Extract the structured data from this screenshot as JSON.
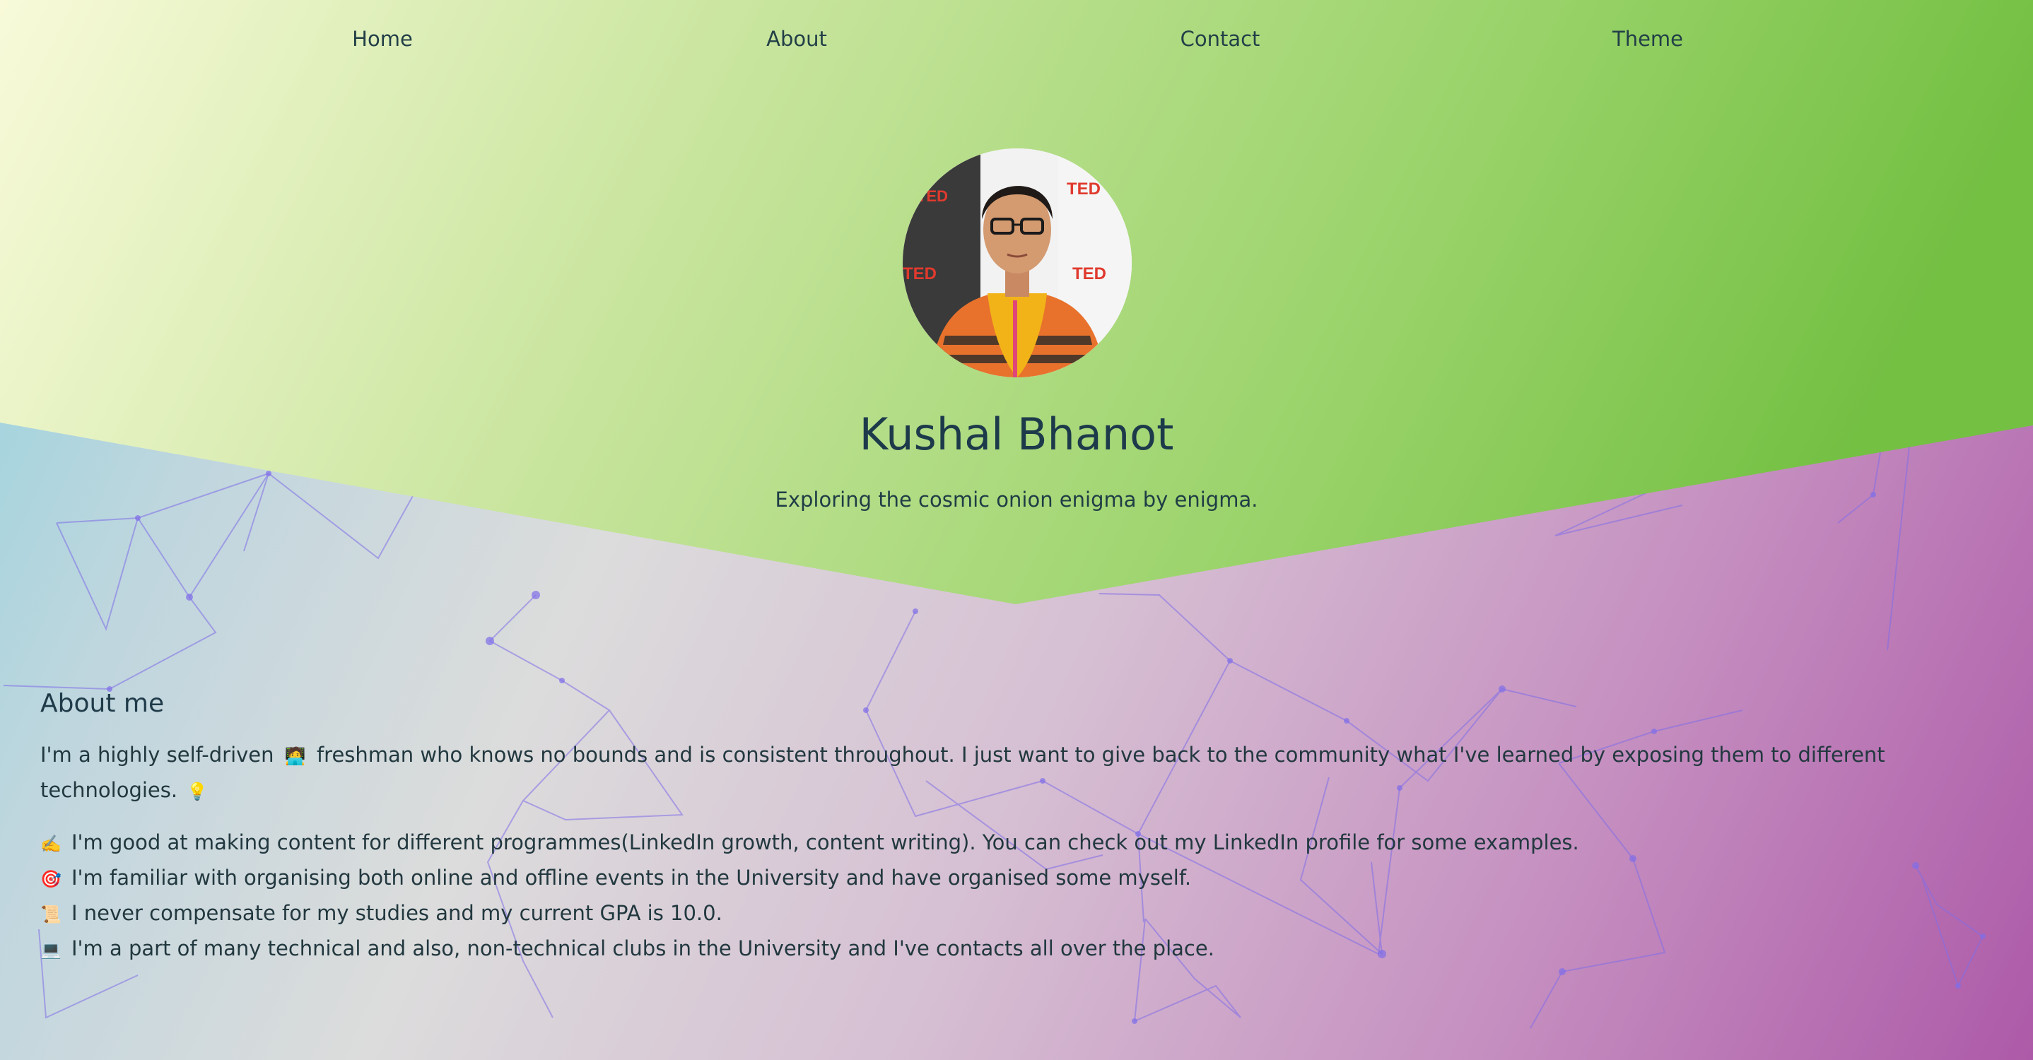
{
  "nav": {
    "items": [
      {
        "id": "home",
        "label": "Home"
      },
      {
        "id": "about",
        "label": "About"
      },
      {
        "id": "contact",
        "label": "Contact"
      },
      {
        "id": "theme",
        "label": "Theme"
      }
    ]
  },
  "profile": {
    "name": "Kushal Bhanot",
    "tagline": "Exploring the cosmic onion enigma by enigma.",
    "avatar_alt": "Kushal Bhanot profile photo",
    "avatar_backdrop_text": "TEDx Chandigarh"
  },
  "about": {
    "heading": "About me",
    "intro_emoji": "🧑‍💻",
    "intro_part1": "I'm a highly self-driven",
    "intro_part2": "freshman who knows no bounds and is consistent throughout. I just want to give back to the community what I've learned by exposing them to different technologies.",
    "intro_end_emoji": "💡",
    "points": [
      {
        "icon": "✍️",
        "icon_name": "writing-hand-icon",
        "text": "I'm good at making content for different programmes(LinkedIn growth, content writing). You can check out my LinkedIn profile for some examples."
      },
      {
        "icon": "🎯",
        "icon_name": "target-icon",
        "text": "I'm familiar with organising both online and offline events in the University and have organised some myself."
      },
      {
        "icon": "📜",
        "icon_name": "scroll-icon",
        "text": "I never compensate for my studies and my current GPA is 10.0."
      },
      {
        "icon": "💻",
        "icon_name": "laptop-icon",
        "text": "I'm a part of many technical and also, non-technical clubs in the University and I've contacts all over the place."
      }
    ]
  },
  "colors": {
    "hero_left": "#f7fad6",
    "hero_right": "#7cc24a",
    "network": "#7f6de8",
    "text": "#1f3d45"
  }
}
